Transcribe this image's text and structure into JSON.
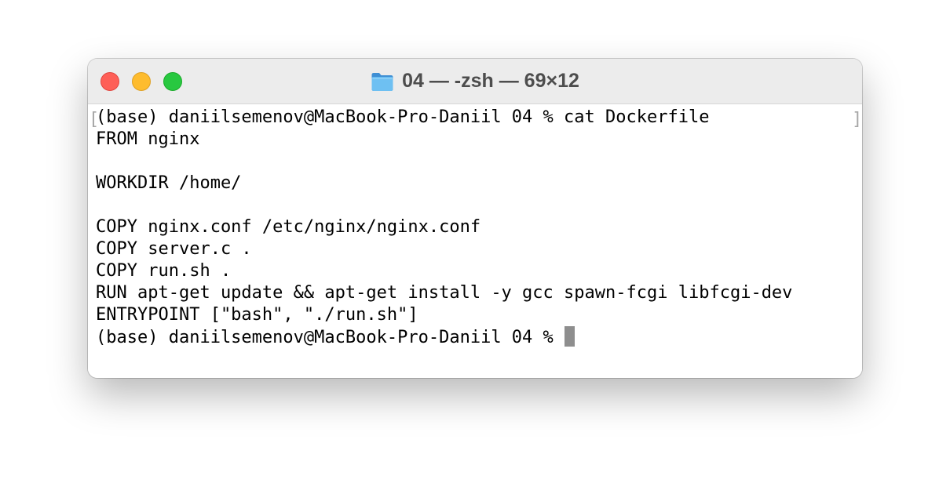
{
  "window": {
    "title": "04 — -zsh — 69×12",
    "folder_icon": "folder-icon",
    "controls": {
      "close": "close-button",
      "minimize": "minimize-button",
      "zoom": "zoom-button"
    },
    "colors": {
      "close": "#fe5f57",
      "minimize": "#febc2e",
      "zoom": "#28c840",
      "folder": "#5fb4ea",
      "cursor": "#8e8e8e"
    }
  },
  "terminal": {
    "mark_left": "[",
    "mark_right": "]",
    "lines": [
      "(base) daniilsemenov@MacBook-Pro-Daniil 04 % cat Dockerfile",
      "FROM nginx",
      "",
      "WORKDIR /home/",
      "",
      "COPY nginx.conf /etc/nginx/nginx.conf",
      "COPY server.c .",
      "COPY run.sh .",
      "RUN apt-get update && apt-get install -y gcc spawn-fcgi libfcgi-dev",
      "ENTRYPOINT [\"bash\", \"./run.sh\"]"
    ],
    "prompt": "(base) daniilsemenov@MacBook-Pro-Daniil 04 % "
  }
}
